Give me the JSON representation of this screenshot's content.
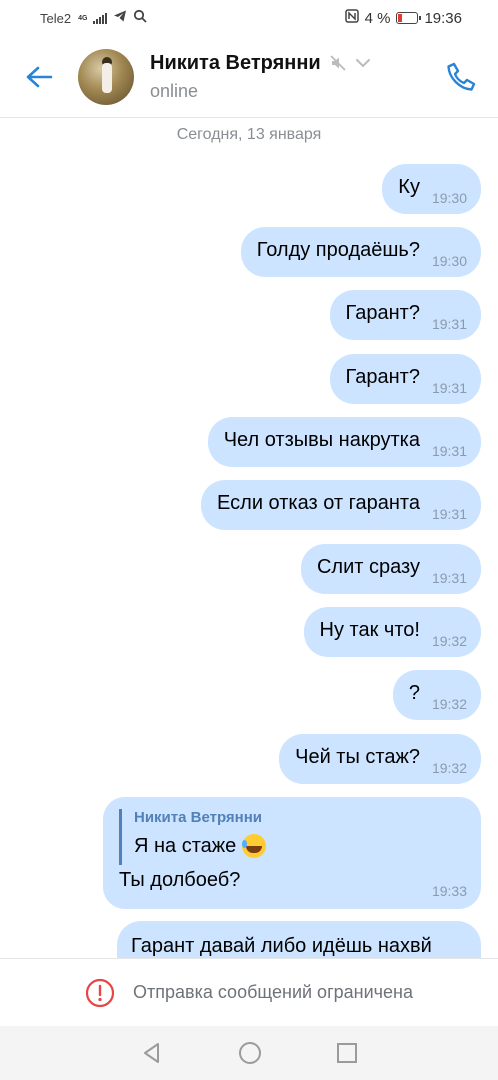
{
  "status_bar": {
    "carrier": "Tele2",
    "network": "4G",
    "battery_text": "4 %",
    "battery_level": 0.04,
    "time": "19:36",
    "icons": [
      "signal-icon",
      "telegram-icon",
      "search-icon",
      "nfc-icon",
      "battery-icon"
    ]
  },
  "header": {
    "contact_name": "Никита Ветрянни",
    "status": "online",
    "icons": [
      "back-arrow-icon",
      "avatar",
      "muted-icon",
      "chevron-down-icon",
      "phone-icon"
    ]
  },
  "chat": {
    "date_separator": "Сегодня, 13 января",
    "messages": [
      {
        "text": "Ку",
        "time": "19:30"
      },
      {
        "text": "Голду продаёшь?",
        "time": "19:30"
      },
      {
        "text": "Гарант?",
        "time": "19:31"
      },
      {
        "text": "Гарант?",
        "time": "19:31"
      },
      {
        "text": "Чел отзывы накрутка",
        "time": "19:31"
      },
      {
        "text": "Если отказ от гаранта",
        "time": "19:31"
      },
      {
        "text": "Слит сразу",
        "time": "19:31"
      },
      {
        "text": "Ну так что!",
        "time": "19:32"
      },
      {
        "text": "?",
        "time": "19:32"
      },
      {
        "text": "Чей ты стаж?",
        "time": "19:32"
      }
    ],
    "reply_message": {
      "quote_author": "Никита Ветрянни",
      "quote_text": "Я на стаже",
      "text": "Ты долбоеб?",
      "time": "19:33"
    },
    "partial_message": {
      "text": "Гарант давай либо идёшь нахвй"
    }
  },
  "restriction": {
    "text": "Отправка сообщений ограничена",
    "accent_color": "#e64646"
  },
  "colors": {
    "bubble": "#cce4ff",
    "accent": "#2a84d6",
    "muted_text": "#8a8e93"
  }
}
